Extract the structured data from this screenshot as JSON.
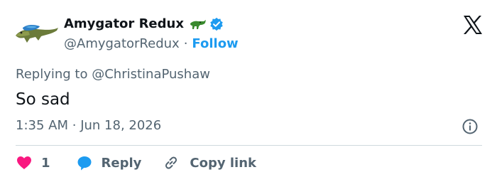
{
  "author": {
    "display_name": "Amygator Redux",
    "handle": "@AmygatorRedux",
    "separator": "·",
    "follow_label": "Follow",
    "name_emoji": "alligator-emoji",
    "verified_badge": "verified-badge-icon"
  },
  "brand": {
    "logo": "x-logo-icon"
  },
  "tweet": {
    "reply_prefix": "Replying to",
    "reply_mention": "@ChristinaPushaw",
    "text": "So sad",
    "time": "1:35 AM",
    "date_separator": "·",
    "date": "Jun 18, 2026"
  },
  "actions": {
    "like_count": "1",
    "reply_label": "Reply",
    "copy_link_label": "Copy link"
  },
  "colors": {
    "accent": "#1d9bf0",
    "like": "#f91880",
    "text_secondary": "#536471",
    "text_primary": "#0f1419",
    "divider": "#cfd9de"
  }
}
